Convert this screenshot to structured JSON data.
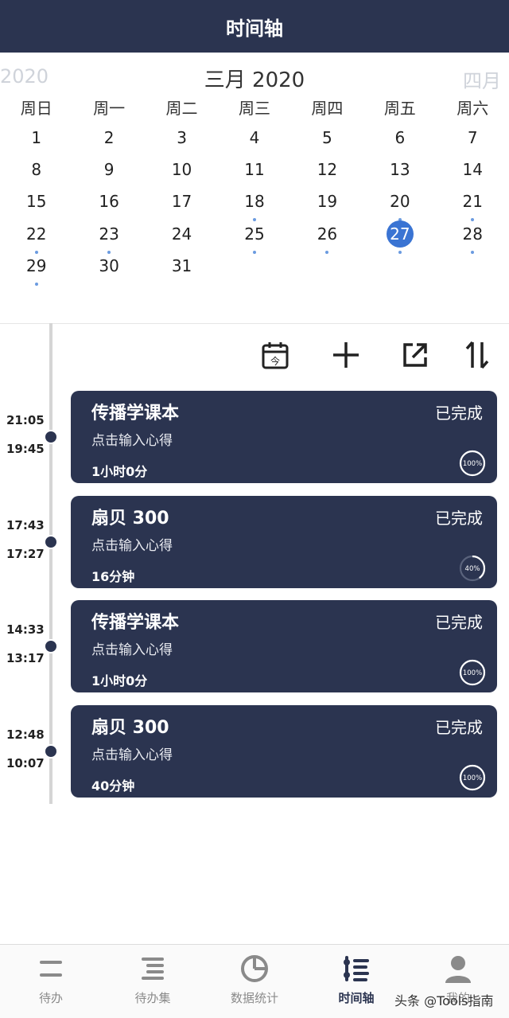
{
  "header": {
    "title": "时间轴"
  },
  "calendar": {
    "prev_label": "2020",
    "current_label": "三月 2020",
    "next_label": "四月",
    "weekdays": [
      "周日",
      "周一",
      "周二",
      "周三",
      "周四",
      "周五",
      "周六"
    ],
    "selected_day": 27,
    "marked_days": [
      18,
      20,
      21,
      22,
      23,
      25,
      26,
      27,
      28,
      29
    ],
    "days": [
      "1",
      "2",
      "3",
      "4",
      "5",
      "6",
      "7",
      "8",
      "9",
      "10",
      "11",
      "12",
      "13",
      "14",
      "15",
      "16",
      "17",
      "18",
      "19",
      "20",
      "21",
      "22",
      "23",
      "24",
      "25",
      "26",
      "27",
      "28",
      "29",
      "30",
      "31"
    ],
    "first_weekday": 0,
    "accent_color": "#3a74d3"
  },
  "toolbar": {
    "icons": [
      "calendar-today-icon",
      "add-icon",
      "export-icon",
      "sort-icon"
    ]
  },
  "entries": [
    {
      "end_time": "21:05",
      "start_time": "19:45",
      "title": "传播学课本",
      "status": "已完成",
      "note": "点击输入心得",
      "duration": "1小时0分",
      "progress_label": "100%",
      "progress": 100
    },
    {
      "end_time": "17:43",
      "start_time": "17:27",
      "title": "扇贝 300",
      "status": "已完成",
      "note": "点击输入心得",
      "duration": "16分钟",
      "progress_label": "40%",
      "progress": 40
    },
    {
      "end_time": "14:33",
      "start_time": "13:17",
      "title": "传播学课本",
      "status": "已完成",
      "note": "点击输入心得",
      "duration": "1小时0分",
      "progress_label": "100%",
      "progress": 100
    },
    {
      "end_time": "12:48",
      "start_time": "10:07",
      "title": "扇贝 300",
      "status": "已完成",
      "note": "点击输入心得",
      "duration": "40分钟",
      "progress_label": "100%",
      "progress": 100
    }
  ],
  "tabs": [
    {
      "label": "待办",
      "icon": "todo-icon",
      "active": false
    },
    {
      "label": "待办集",
      "icon": "todo-set-icon",
      "active": false
    },
    {
      "label": "数据统计",
      "icon": "pie-chart-icon",
      "active": false
    },
    {
      "label": "时间轴",
      "icon": "timeline-icon",
      "active": true
    },
    {
      "label": "我的",
      "icon": "user-icon",
      "active": false
    }
  ],
  "watermark": "头条 @Tools指南",
  "colors": {
    "header_bg": "#2b3450",
    "card_bg": "#2b3450",
    "selected_day": "#3a74d3",
    "dot": "#6b9be0"
  }
}
